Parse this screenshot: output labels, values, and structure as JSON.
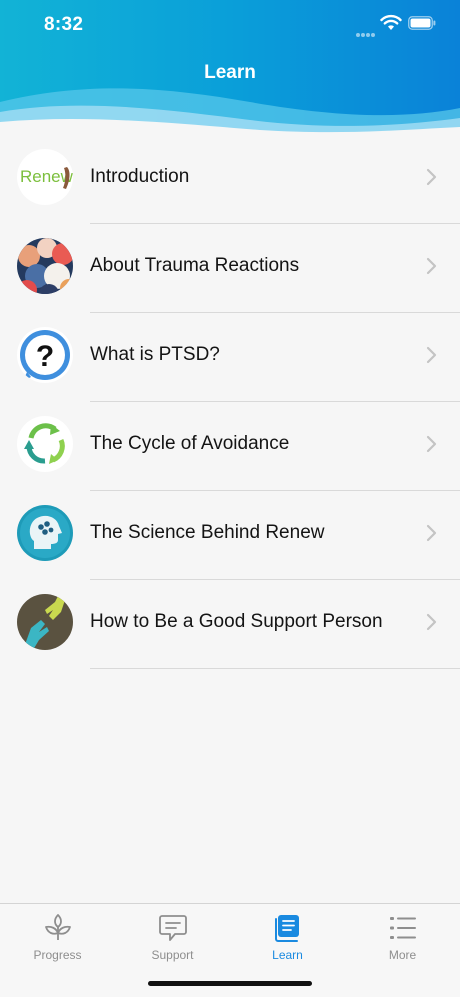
{
  "status_bar": {
    "time": "8:32"
  },
  "header": {
    "title": "Learn"
  },
  "colors": {
    "header_start": "#12b3d6",
    "header_end": "#0a82d8",
    "active_tab": "#1a8ae0",
    "inactive_tab": "#8e8e8e"
  },
  "list": {
    "items": [
      {
        "label": "Introduction",
        "thumbnail_text": "Renew"
      },
      {
        "label": "About Trauma Reactions"
      },
      {
        "label": "What is PTSD?"
      },
      {
        "label": "The Cycle of Avoidance"
      },
      {
        "label": "The Science Behind Renew"
      },
      {
        "label": "How to Be a Good Support Person"
      }
    ]
  },
  "tab_bar": {
    "tabs": [
      {
        "label": "Progress",
        "icon": "sprout-icon",
        "active": false
      },
      {
        "label": "Support",
        "icon": "speech-bubble-icon",
        "active": false
      },
      {
        "label": "Learn",
        "icon": "book-icon",
        "active": true
      },
      {
        "label": "More",
        "icon": "list-icon",
        "active": false
      }
    ]
  }
}
